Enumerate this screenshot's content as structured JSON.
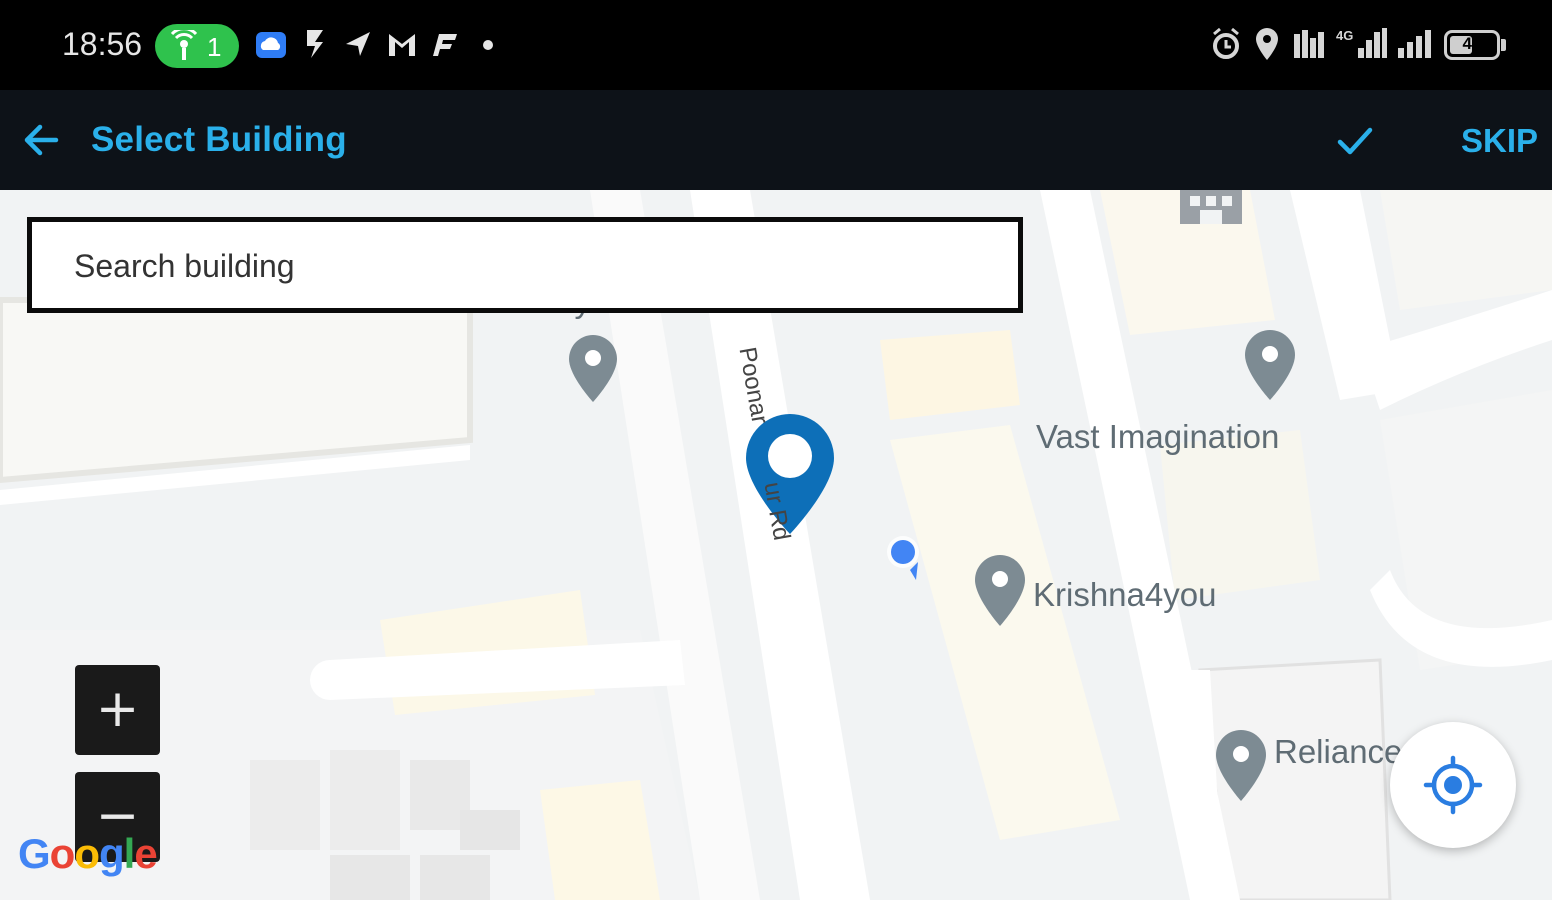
{
  "status_bar": {
    "time": "18:56",
    "hotspot_count": "1",
    "battery": "48",
    "icons": [
      "hotspot-icon",
      "cloud-app-icon",
      "payment-app-icon",
      "send-icon",
      "gmail-icon",
      "paytm-icon",
      "notification-dot-icon",
      "alarm-icon",
      "location-icon",
      "volte-icon",
      "signal-4g-icon",
      "signal-icon",
      "battery-icon"
    ]
  },
  "app_bar": {
    "title": "Select Building",
    "skip_label": "SKIP",
    "accent_color": "#2ab0ea"
  },
  "search": {
    "placeholder": "Search building"
  },
  "map": {
    "places": [
      "Sai Tiyer",
      "Vast Imagination",
      "Krishna4you",
      "Reliance"
    ],
    "road_name": "Poonar",
    "road_name_2": "ur Rd",
    "selected_pin_color": "#0d6fb8",
    "zoom_in_label": "+",
    "zoom_out_label": "−",
    "attribution": "Google"
  }
}
